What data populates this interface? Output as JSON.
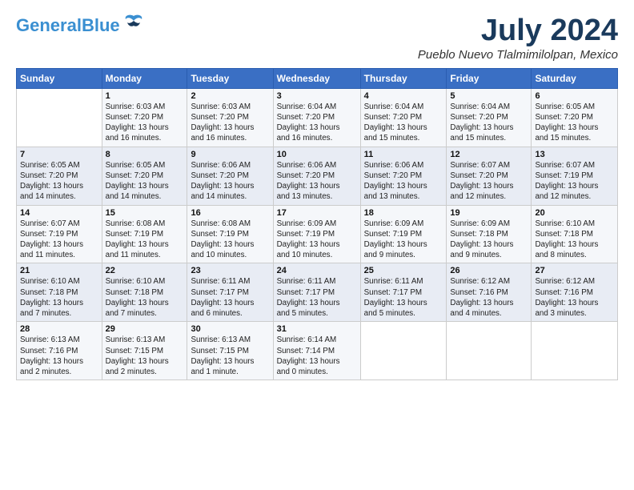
{
  "header": {
    "logo_line1": "General",
    "logo_line2": "Blue",
    "month_year": "July 2024",
    "location": "Pueblo Nuevo Tlalmimilolpan, Mexico"
  },
  "days_of_week": [
    "Sunday",
    "Monday",
    "Tuesday",
    "Wednesday",
    "Thursday",
    "Friday",
    "Saturday"
  ],
  "weeks": [
    [
      {
        "day": "",
        "info": ""
      },
      {
        "day": "1",
        "info": "Sunrise: 6:03 AM\nSunset: 7:20 PM\nDaylight: 13 hours\nand 16 minutes."
      },
      {
        "day": "2",
        "info": "Sunrise: 6:03 AM\nSunset: 7:20 PM\nDaylight: 13 hours\nand 16 minutes."
      },
      {
        "day": "3",
        "info": "Sunrise: 6:04 AM\nSunset: 7:20 PM\nDaylight: 13 hours\nand 16 minutes."
      },
      {
        "day": "4",
        "info": "Sunrise: 6:04 AM\nSunset: 7:20 PM\nDaylight: 13 hours\nand 15 minutes."
      },
      {
        "day": "5",
        "info": "Sunrise: 6:04 AM\nSunset: 7:20 PM\nDaylight: 13 hours\nand 15 minutes."
      },
      {
        "day": "6",
        "info": "Sunrise: 6:05 AM\nSunset: 7:20 PM\nDaylight: 13 hours\nand 15 minutes."
      }
    ],
    [
      {
        "day": "7",
        "info": "Sunrise: 6:05 AM\nSunset: 7:20 PM\nDaylight: 13 hours\nand 14 minutes."
      },
      {
        "day": "8",
        "info": "Sunrise: 6:05 AM\nSunset: 7:20 PM\nDaylight: 13 hours\nand 14 minutes."
      },
      {
        "day": "9",
        "info": "Sunrise: 6:06 AM\nSunset: 7:20 PM\nDaylight: 13 hours\nand 14 minutes."
      },
      {
        "day": "10",
        "info": "Sunrise: 6:06 AM\nSunset: 7:20 PM\nDaylight: 13 hours\nand 13 minutes."
      },
      {
        "day": "11",
        "info": "Sunrise: 6:06 AM\nSunset: 7:20 PM\nDaylight: 13 hours\nand 13 minutes."
      },
      {
        "day": "12",
        "info": "Sunrise: 6:07 AM\nSunset: 7:20 PM\nDaylight: 13 hours\nand 12 minutes."
      },
      {
        "day": "13",
        "info": "Sunrise: 6:07 AM\nSunset: 7:19 PM\nDaylight: 13 hours\nand 12 minutes."
      }
    ],
    [
      {
        "day": "14",
        "info": "Sunrise: 6:07 AM\nSunset: 7:19 PM\nDaylight: 13 hours\nand 11 minutes."
      },
      {
        "day": "15",
        "info": "Sunrise: 6:08 AM\nSunset: 7:19 PM\nDaylight: 13 hours\nand 11 minutes."
      },
      {
        "day": "16",
        "info": "Sunrise: 6:08 AM\nSunset: 7:19 PM\nDaylight: 13 hours\nand 10 minutes."
      },
      {
        "day": "17",
        "info": "Sunrise: 6:09 AM\nSunset: 7:19 PM\nDaylight: 13 hours\nand 10 minutes."
      },
      {
        "day": "18",
        "info": "Sunrise: 6:09 AM\nSunset: 7:19 PM\nDaylight: 13 hours\nand 9 minutes."
      },
      {
        "day": "19",
        "info": "Sunrise: 6:09 AM\nSunset: 7:18 PM\nDaylight: 13 hours\nand 9 minutes."
      },
      {
        "day": "20",
        "info": "Sunrise: 6:10 AM\nSunset: 7:18 PM\nDaylight: 13 hours\nand 8 minutes."
      }
    ],
    [
      {
        "day": "21",
        "info": "Sunrise: 6:10 AM\nSunset: 7:18 PM\nDaylight: 13 hours\nand 7 minutes."
      },
      {
        "day": "22",
        "info": "Sunrise: 6:10 AM\nSunset: 7:18 PM\nDaylight: 13 hours\nand 7 minutes."
      },
      {
        "day": "23",
        "info": "Sunrise: 6:11 AM\nSunset: 7:17 PM\nDaylight: 13 hours\nand 6 minutes."
      },
      {
        "day": "24",
        "info": "Sunrise: 6:11 AM\nSunset: 7:17 PM\nDaylight: 13 hours\nand 5 minutes."
      },
      {
        "day": "25",
        "info": "Sunrise: 6:11 AM\nSunset: 7:17 PM\nDaylight: 13 hours\nand 5 minutes."
      },
      {
        "day": "26",
        "info": "Sunrise: 6:12 AM\nSunset: 7:16 PM\nDaylight: 13 hours\nand 4 minutes."
      },
      {
        "day": "27",
        "info": "Sunrise: 6:12 AM\nSunset: 7:16 PM\nDaylight: 13 hours\nand 3 minutes."
      }
    ],
    [
      {
        "day": "28",
        "info": "Sunrise: 6:13 AM\nSunset: 7:16 PM\nDaylight: 13 hours\nand 2 minutes."
      },
      {
        "day": "29",
        "info": "Sunrise: 6:13 AM\nSunset: 7:15 PM\nDaylight: 13 hours\nand 2 minutes."
      },
      {
        "day": "30",
        "info": "Sunrise: 6:13 AM\nSunset: 7:15 PM\nDaylight: 13 hours\nand 1 minute."
      },
      {
        "day": "31",
        "info": "Sunrise: 6:14 AM\nSunset: 7:14 PM\nDaylight: 13 hours\nand 0 minutes."
      },
      {
        "day": "",
        "info": ""
      },
      {
        "day": "",
        "info": ""
      },
      {
        "day": "",
        "info": ""
      }
    ]
  ]
}
